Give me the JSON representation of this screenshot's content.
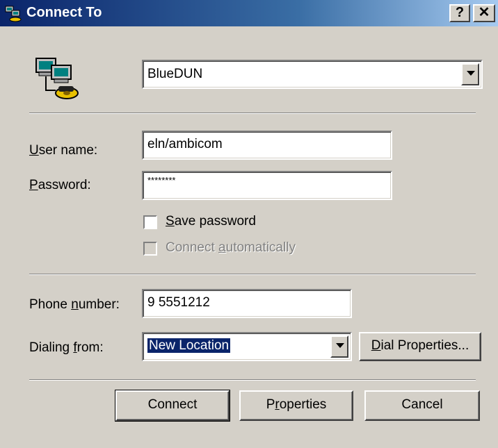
{
  "window": {
    "title": "Connect To",
    "help_glyph": "?",
    "close_glyph": "✕"
  },
  "connection": {
    "name": "BlueDUN"
  },
  "user_name": {
    "label_accel": "U",
    "label_rest": "ser name:",
    "value": "eln/ambicom"
  },
  "password": {
    "label_accel": "P",
    "label_rest": "assword:",
    "value": "********"
  },
  "save_password": {
    "accel": "S",
    "rest": "ave password",
    "checked": false
  },
  "connect_auto": {
    "pre": "Connect ",
    "accel": "a",
    "rest": "utomatically",
    "checked": false,
    "disabled": true
  },
  "phone": {
    "label_pre": "Phone ",
    "label_accel": "n",
    "label_rest": "umber:",
    "value": "9 5551212"
  },
  "dialing": {
    "label_pre": "Dialing ",
    "label_accel": "f",
    "label_rest": "rom:",
    "value": "New Location"
  },
  "buttons": {
    "dial_props_accel": "D",
    "dial_props_rest": "ial Properties...",
    "connect": "Connect",
    "props_pre": "P",
    "props_accel": "r",
    "props_rest": "operties",
    "cancel": "Cancel"
  },
  "icons": {
    "title": "connection-icon",
    "connection": "dialup-computer-phone-icon"
  }
}
